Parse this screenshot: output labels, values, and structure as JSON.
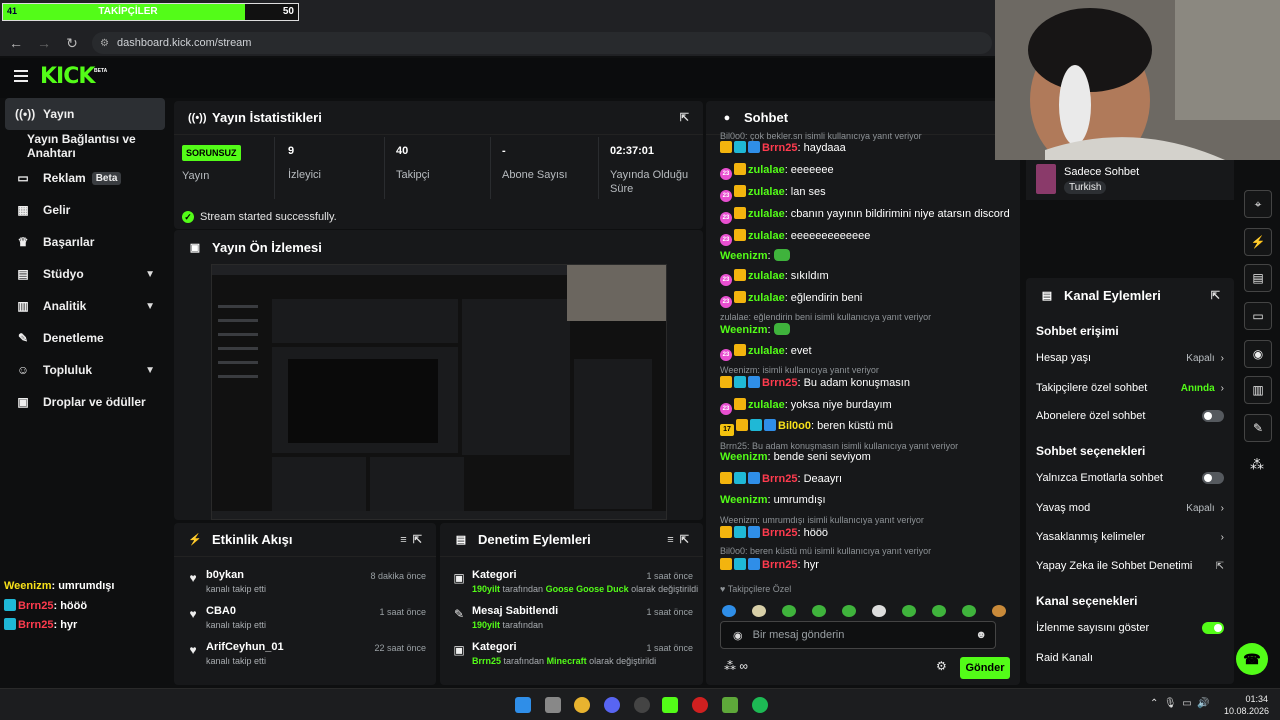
{
  "overlay": {
    "left_value": "41",
    "title": "TAKİPÇİLER",
    "right_value": "50",
    "progress_percent": 82
  },
  "browser": {
    "url": "dashboard.kick.com/stream"
  },
  "brand": {
    "logo": "KICK",
    "beta": "BETA"
  },
  "sidebar": {
    "items": [
      {
        "label": "Yayın",
        "icon": "broadcast-icon"
      },
      {
        "label": "Yayın Bağlantısı ve Anahtarı",
        "icon": ""
      },
      {
        "label": "Reklam",
        "badge": "Beta",
        "icon": "tv-icon"
      },
      {
        "label": "Gelir",
        "icon": "chart-icon"
      },
      {
        "label": "Başarılar",
        "icon": "trophy-icon"
      },
      {
        "label": "Stüdyo",
        "icon": "studio-icon"
      },
      {
        "label": "Analitik",
        "icon": "analytics-icon"
      },
      {
        "label": "Denetleme",
        "icon": "wrench-icon"
      },
      {
        "label": "Topluluk",
        "icon": "people-icon"
      },
      {
        "label": "Droplar ve ödüller",
        "icon": "gift-icon"
      }
    ]
  },
  "overlay_chat": [
    {
      "user": "Weenizm",
      "text": ": umrumdışı"
    },
    {
      "user": "Brrn25",
      "text": ": hööö"
    },
    {
      "user": "Brrn25",
      "text": ": hyr"
    }
  ],
  "stats": {
    "title": "Yayın İstatistikleri",
    "status": "SORUNSUZ",
    "status_label": "Yayın",
    "viewers": "9",
    "viewers_label": "İzleyici",
    "followers": "40",
    "followers_label": "Takipçi",
    "subs": "-",
    "subs_label": "Abone Sayısı",
    "uptime": "02:37:01",
    "uptime_label": "Yayında Olduğu Süre",
    "success": "Stream started successfully."
  },
  "preview": {
    "title": "Yayın Ön İzlemesi"
  },
  "activity": {
    "title": "Etkinlik Akışı",
    "items": [
      {
        "name": "b0ykan",
        "sub": "kanalı takip etti",
        "time": "8 dakika önce"
      },
      {
        "name": "CBA0",
        "sub": "kanalı takip etti",
        "time": "1 saat önce"
      },
      {
        "name": "ArifCeyhun_01",
        "sub": "kanalı takip etti",
        "time": "22 saat önce"
      }
    ]
  },
  "moderation": {
    "title": "Denetim Eylemleri",
    "items": [
      {
        "name": "Kategori",
        "actor": "190yilt",
        "mid": " tarafından ",
        "target": "Goose Goose Duck",
        "tail": " olarak değiştirildi",
        "time": "1 saat önce"
      },
      {
        "name": "Mesaj Sabitlendi",
        "actor": "190yilt",
        "mid": " tarafından",
        "target": "",
        "tail": "",
        "time": "1 saat önce"
      },
      {
        "name": "Kategori",
        "actor": "Brrn25",
        "mid": " tarafından ",
        "target": "Minecraft",
        "tail": " olarak değiştirildi",
        "time": "1 saat önce"
      }
    ]
  },
  "chat": {
    "title": "Sohbet",
    "messages": [
      {
        "type": "reply",
        "text": "Bil0o0: çok bekler.sn isimli kullanıcıya yanıt veriyor"
      },
      {
        "user": "Brrn25",
        "text": ": haydaaa"
      },
      {
        "user": "zulalae",
        "text": ": eeeeeee"
      },
      {
        "user": "zulalae",
        "text": ": lan ses"
      },
      {
        "user": "zulalae",
        "text": ": cbanın yayının bildirimini niye atarsın discord"
      },
      {
        "user": "zulalae",
        "text": ": eeeeeeeeeeeee"
      },
      {
        "user": "Weenizm",
        "text": ":"
      },
      {
        "user": "zulalae",
        "text": ": sıkıldım"
      },
      {
        "user": "zulalae",
        "text": ": eğlendirin beni"
      },
      {
        "type": "reply",
        "text": "zulalae: eğlendirin beni isimli kullanıcıya yanıt veriyor"
      },
      {
        "user": "Weenizm",
        "text": ":"
      },
      {
        "user": "zulalae",
        "text": ": evet"
      },
      {
        "type": "reply",
        "text": "Weenizm: isimli kullanıcıya yanıt veriyor"
      },
      {
        "user": "Brrn25",
        "text": ": Bu adam konuşmasın"
      },
      {
        "user": "zulalae",
        "text": ": yoksa niye burdayım"
      },
      {
        "user": "Bil0o0",
        "text": ": beren küstü mü"
      },
      {
        "type": "reply",
        "text": "Brrn25: Bu adam konuşmasın isimli kullanıcıya yanıt veriyor"
      },
      {
        "user": "Weenizm",
        "text": ": bende seni seviyom"
      },
      {
        "user": "Brrn25",
        "text": ": Deaayrı"
      },
      {
        "user": "Weenizm",
        "text": ": umrumdışı"
      },
      {
        "type": "reply",
        "text": "Weenizm: umrumdışı isimli kullanıcıya yanıt veriyor"
      },
      {
        "user": "Brrn25",
        "text": ": hööö"
      },
      {
        "type": "reply",
        "text": "Bil0o0: beren küstü mü isimli kullanıcıya yanıt veriyor"
      },
      {
        "user": "Brrn25",
        "text": ": hyr"
      }
    ],
    "followers_only": "Takipçilere Özel",
    "placeholder": "Bir mesaj gönderin",
    "send": "Gönder",
    "infinity": "∞"
  },
  "chat_mode": {
    "label": "Sadece Sohbet",
    "lang": "Turkish"
  },
  "channel": {
    "title": "Kanal Eylemleri",
    "access_title": "Sohbet erişimi",
    "account_age": "Hesap yaşı",
    "account_age_val": "Kapalı",
    "followers_chat": "Takipçilere özel sohbet",
    "followers_chat_val": "Anında",
    "subs_chat": "Abonelere özel sohbet",
    "options_title": "Sohbet seçenekleri",
    "emote_only": "Yalnızca Emotlarla sohbet",
    "slow_mode": "Yavaş mod",
    "slow_mode_val": "Kapalı",
    "banned_words": "Yasaklanmış kelimeler",
    "ai_mod": "Yapay Zeka ile Sohbet Denetimi",
    "channel_options_title": "Kanal seçenekleri",
    "show_viewers": "İzlenme sayısını göster",
    "raid": "Raid Kanalı"
  },
  "tray": {
    "time": "01:34",
    "date": "10.08.2026"
  },
  "colors": {
    "accent": "#53fc18",
    "panel": "#17181a",
    "bg": "#0e0f10"
  }
}
